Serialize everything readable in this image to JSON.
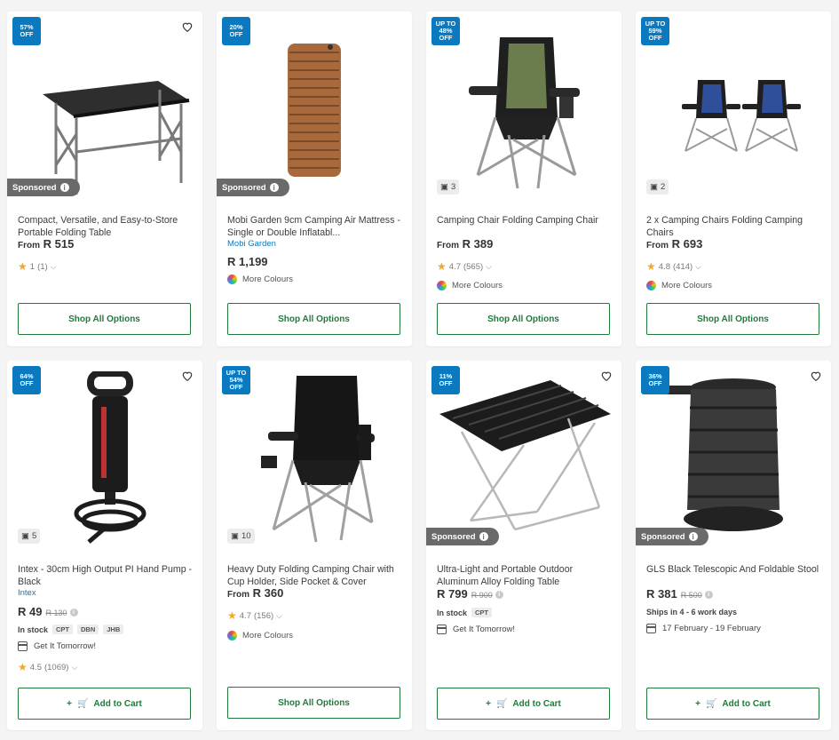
{
  "products": [
    {
      "badge": [
        "57%",
        "OFF"
      ],
      "sponsored": "Sponsored",
      "title": "Compact, Versatile, and Easy-to-Store Portable Folding Table",
      "price_prefix": "From",
      "price": "R 515",
      "rating": "1",
      "reviews": "(1)",
      "button": "Shop All Options"
    },
    {
      "badge": [
        "20%",
        "OFF"
      ],
      "sponsored": "Sponsored",
      "title": "Mobi Garden 9cm Camping Air Mattress - Single or Double Inflatabl...",
      "brand": "Mobi Garden",
      "price": "R 1,199",
      "colours": "More Colours",
      "button": "Shop All Options"
    },
    {
      "badge": [
        "UP TO",
        "48%",
        "OFF"
      ],
      "photos": "3",
      "title": "Camping Chair Folding Camping Chair",
      "price_prefix": "From",
      "price": "R 389",
      "rating": "4.7",
      "reviews": "(565)",
      "colours": "More Colours",
      "button": "Shop All Options"
    },
    {
      "badge": [
        "UP TO",
        "59%",
        "OFF"
      ],
      "photos": "2",
      "title": "2 x Camping Chairs Folding Camping Chairs",
      "price_prefix": "From",
      "price": "R 693",
      "rating": "4.8",
      "reviews": "(414)",
      "colours": "More Colours",
      "button": "Shop All Options"
    },
    {
      "badge": [
        "64%",
        "OFF"
      ],
      "photos": "5",
      "title": "Intex - 30cm High Output PI Hand Pump - Black",
      "brand": "Intex",
      "price": "R 49",
      "old_price": "R 130",
      "stock": "In stock",
      "chips": [
        "CPT",
        "DBN",
        "JHB"
      ],
      "delivery": "Get It Tomorrow!",
      "rating": "4.5",
      "reviews": "(1069)",
      "button": "Add to Cart"
    },
    {
      "badge": [
        "UP TO",
        "54%",
        "OFF"
      ],
      "photos": "10",
      "title": "Heavy Duty Folding Camping Chair with Cup Holder, Side Pocket & Cover",
      "price_prefix": "From",
      "price": "R 360",
      "rating": "4.7",
      "reviews": "(156)",
      "colours": "More Colours",
      "button": "Shop All Options"
    },
    {
      "badge": [
        "11%",
        "OFF"
      ],
      "sponsored": "Sponsored",
      "title": "Ultra-Light and Portable Outdoor Aluminum Alloy Folding Table",
      "price": "R 799",
      "old_price": "R 900",
      "stock": "In stock",
      "chips": [
        "CPT"
      ],
      "delivery": "Get It Tomorrow!",
      "button": "Add to Cart"
    },
    {
      "badge": [
        "36%",
        "OFF"
      ],
      "sponsored": "Sponsored",
      "title": "GLS Black Telescopic And Foldable Stool",
      "price": "R 381",
      "old_price": "R 500",
      "ships": "Ships in 4 - 6 work days",
      "delivery": "17 February - 19 February",
      "button": "Add to Cart"
    }
  ],
  "colors": {
    "accent_green": "#1e7b3a",
    "badge_blue": "#0b79bf",
    "star": "#f5a623",
    "brand_link": "#0b79bf"
  },
  "icons": {
    "heart": "heart-icon",
    "camera": "camera-icon",
    "cart": "cart-icon",
    "info": "info-icon",
    "calendar": "calendar-icon"
  }
}
